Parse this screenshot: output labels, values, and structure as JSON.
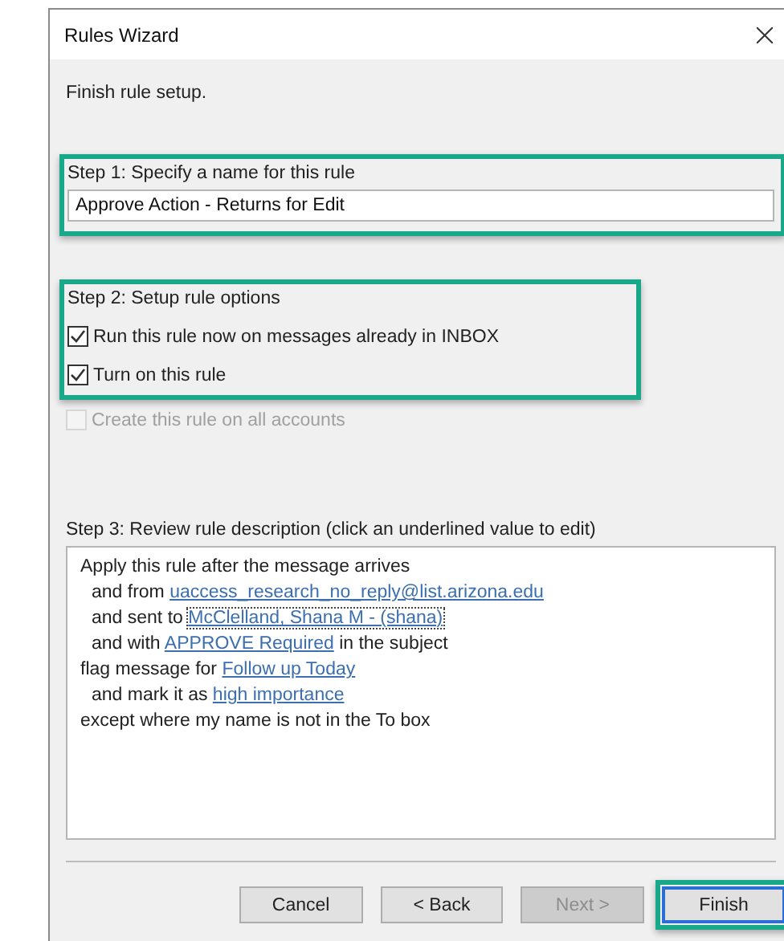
{
  "window": {
    "title": "Rules Wizard"
  },
  "heading": "Finish rule setup.",
  "step1": {
    "label": "Step 1: Specify a name for this rule",
    "value": "Approve Action - Returns for Edit",
    "highlighted": true
  },
  "step2": {
    "label": "Step 2: Setup rule options",
    "highlighted": true,
    "options": [
      {
        "label": "Run this rule now on messages already in INBOX",
        "checked": true,
        "disabled": false
      },
      {
        "label": "Turn on this rule",
        "checked": true,
        "disabled": false
      }
    ]
  },
  "extra_option": {
    "label": "Create this rule on all accounts",
    "checked": false,
    "disabled": true
  },
  "step3": {
    "label": "Step 3: Review rule description (click an underlined value to edit)",
    "lines": [
      {
        "indent": false,
        "parts": [
          {
            "kind": "text",
            "text": "Apply this rule after the message arrives"
          }
        ]
      },
      {
        "indent": true,
        "parts": [
          {
            "kind": "text",
            "text": "and from "
          },
          {
            "kind": "link",
            "text": "uaccess_research_no_reply@list.arizona.edu",
            "focused": false
          }
        ]
      },
      {
        "indent": true,
        "parts": [
          {
            "kind": "text",
            "text": "and sent to "
          },
          {
            "kind": "link",
            "text": "McClelland, Shana M - (shana)",
            "focused": true
          }
        ]
      },
      {
        "indent": true,
        "parts": [
          {
            "kind": "text",
            "text": "and with "
          },
          {
            "kind": "link",
            "text": "APPROVE Required",
            "focused": false
          },
          {
            "kind": "text",
            "text": " in the subject"
          }
        ]
      },
      {
        "indent": false,
        "parts": [
          {
            "kind": "text",
            "text": "flag message for "
          },
          {
            "kind": "link",
            "text": "Follow up Today",
            "focused": false
          }
        ]
      },
      {
        "indent": true,
        "parts": [
          {
            "kind": "text",
            "text": "and mark it as "
          },
          {
            "kind": "link",
            "text": "high importance",
            "focused": false
          }
        ]
      },
      {
        "indent": false,
        "parts": [
          {
            "kind": "text",
            "text": "except where my name is not in the To box"
          }
        ]
      }
    ]
  },
  "buttons": [
    {
      "label": "Cancel",
      "disabled": false,
      "default": false,
      "highlighted": false
    },
    {
      "label": "< Back",
      "disabled": false,
      "default": false,
      "highlighted": false
    },
    {
      "label": "Next >",
      "disabled": true,
      "default": false,
      "highlighted": false
    },
    {
      "label": "Finish",
      "disabled": false,
      "default": true,
      "highlighted": true
    }
  ]
}
